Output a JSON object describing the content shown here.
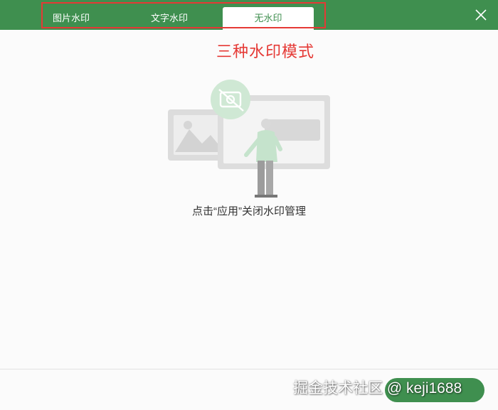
{
  "tabs": [
    {
      "label": "图片水印",
      "active": false
    },
    {
      "label": "文字水印",
      "active": false
    },
    {
      "label": "无水印",
      "active": true
    }
  ],
  "annotation": "三种水印模式",
  "caption": "点击“应用”关闭水印管理",
  "watermark_text": "掘金技术社区 @ keji1688",
  "icons": {
    "close": "close-icon"
  },
  "colors": {
    "accent": "#3f8f4f",
    "annotation": "#e53935",
    "topbar": "#3f8f4f"
  }
}
